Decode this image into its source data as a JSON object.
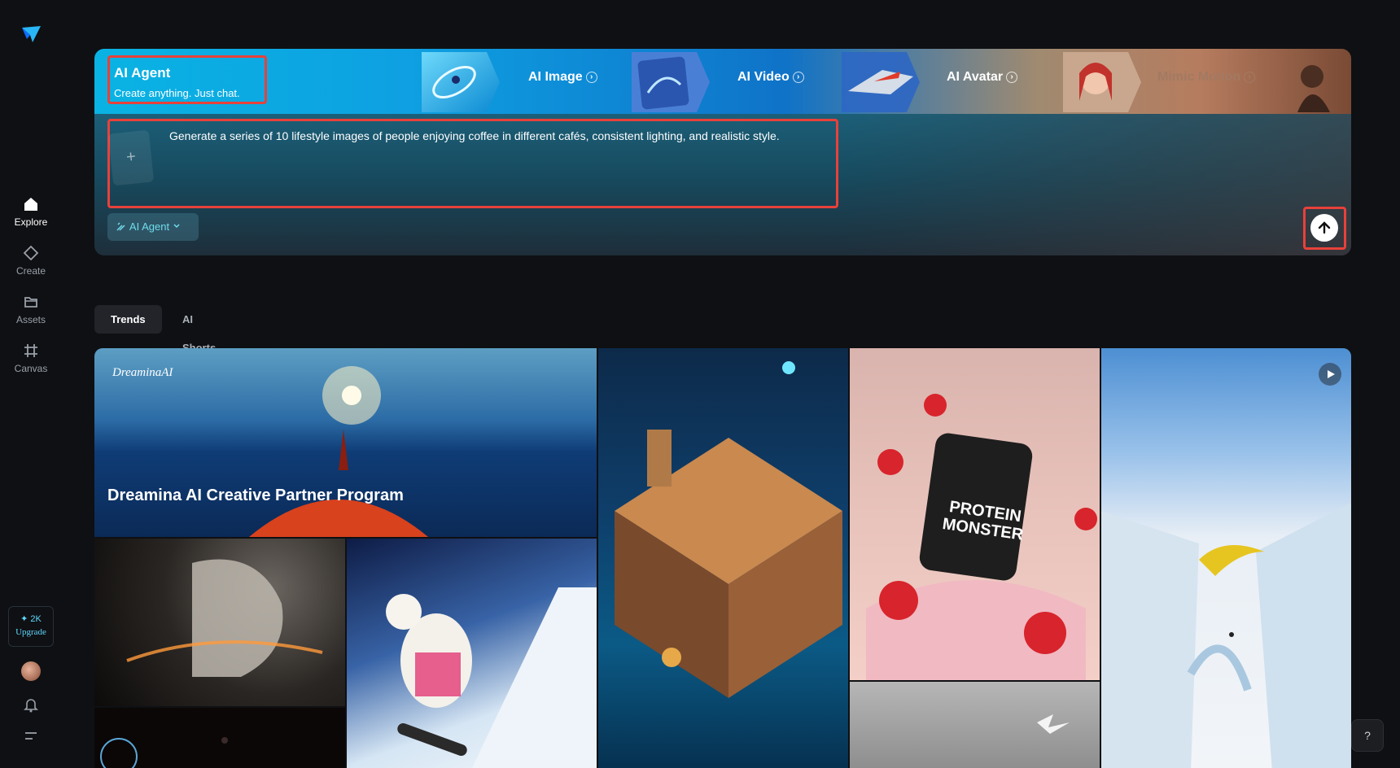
{
  "sidebar": {
    "items": [
      {
        "label": "Explore",
        "icon": "home-icon"
      },
      {
        "label": "Create",
        "icon": "diamond-icon"
      },
      {
        "label": "Assets",
        "icon": "folder-icon"
      },
      {
        "label": "Canvas",
        "icon": "canvas-icon"
      }
    ],
    "credits": "✦ 2K",
    "upgrade": "Upgrade"
  },
  "hero": {
    "agent_title": "AI Agent",
    "agent_subtitle": "Create anything. Just chat.",
    "modes": [
      {
        "label": "AI Image"
      },
      {
        "label": "AI Video"
      },
      {
        "label": "AI Avatar"
      },
      {
        "label": "Mimic Motion"
      }
    ],
    "prompt": "Generate a series of 10 lifestyle images of people enjoying coffee in different cafés, consistent lighting, and realistic style.",
    "upload_symbol": "+",
    "agent_select": "AI Agent",
    "accent": "#e8413a"
  },
  "tabs": [
    {
      "label": "Trends"
    },
    {
      "label": "AI Shorts"
    }
  ],
  "gallery": {
    "banner_logo": "DreaminaAI",
    "banner_title": "Dreamina AI Creative Partner Program",
    "product_label": [
      "PROTEIN",
      "MONSTER"
    ]
  },
  "help": "?"
}
